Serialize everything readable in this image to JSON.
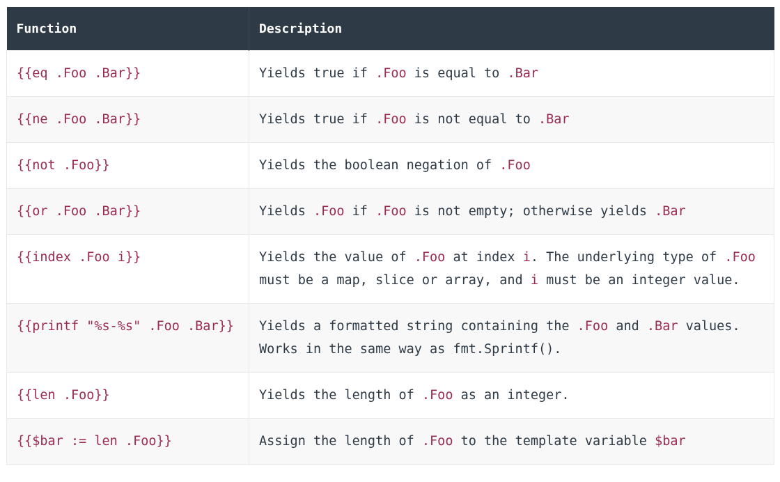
{
  "table": {
    "headers": [
      "Function",
      "Description"
    ],
    "rows": [
      {
        "function": "{{eq .Foo .Bar}}",
        "description": [
          {
            "t": "Yields true if "
          },
          {
            "t": ".Foo",
            "code": true
          },
          {
            "t": " is equal to "
          },
          {
            "t": ".Bar",
            "code": true
          }
        ]
      },
      {
        "function": "{{ne .Foo .Bar}}",
        "description": [
          {
            "t": "Yields true if "
          },
          {
            "t": ".Foo",
            "code": true
          },
          {
            "t": " is not equal to "
          },
          {
            "t": ".Bar",
            "code": true
          }
        ]
      },
      {
        "function": "{{not .Foo}}",
        "description": [
          {
            "t": "Yields the boolean negation of "
          },
          {
            "t": ".Foo",
            "code": true
          }
        ]
      },
      {
        "function": "{{or .Foo .Bar}}",
        "description": [
          {
            "t": "Yields "
          },
          {
            "t": ".Foo",
            "code": true
          },
          {
            "t": " if "
          },
          {
            "t": ".Foo",
            "code": true
          },
          {
            "t": " is not empty; otherwise yields "
          },
          {
            "t": ".Bar",
            "code": true
          }
        ]
      },
      {
        "function": "{{index .Foo i}}",
        "description": [
          {
            "t": "Yields the value of "
          },
          {
            "t": ".Foo",
            "code": true
          },
          {
            "t": " at index "
          },
          {
            "t": "i",
            "code": true
          },
          {
            "t": ". The underlying type of "
          },
          {
            "t": ".Foo",
            "code": true
          },
          {
            "t": " must be a map, slice or array, and "
          },
          {
            "t": "i",
            "code": true
          },
          {
            "t": " must be an integer value."
          }
        ]
      },
      {
        "function": "{{printf \"%s-%s\" .Foo .Bar}}",
        "description": [
          {
            "t": "Yields a formatted string containing the "
          },
          {
            "t": ".Foo",
            "code": true
          },
          {
            "t": " and "
          },
          {
            "t": ".Bar",
            "code": true
          },
          {
            "t": " values. Works in the same way as fmt.Sprintf()."
          }
        ]
      },
      {
        "function": "{{len .Foo}}",
        "description": [
          {
            "t": "Yields the length of "
          },
          {
            "t": ".Foo",
            "code": true
          },
          {
            "t": " as an integer."
          }
        ]
      },
      {
        "function": "{{$bar := len .Foo}}",
        "description": [
          {
            "t": "Assign the length of "
          },
          {
            "t": ".Foo",
            "code": true
          },
          {
            "t": " to the template variable "
          },
          {
            "t": "$bar",
            "code": true
          }
        ]
      }
    ]
  },
  "colors": {
    "header_bg": "#2e3a46",
    "code": "#9b2a52",
    "text": "#2e3a46",
    "stripe": "#f8f8f8"
  }
}
